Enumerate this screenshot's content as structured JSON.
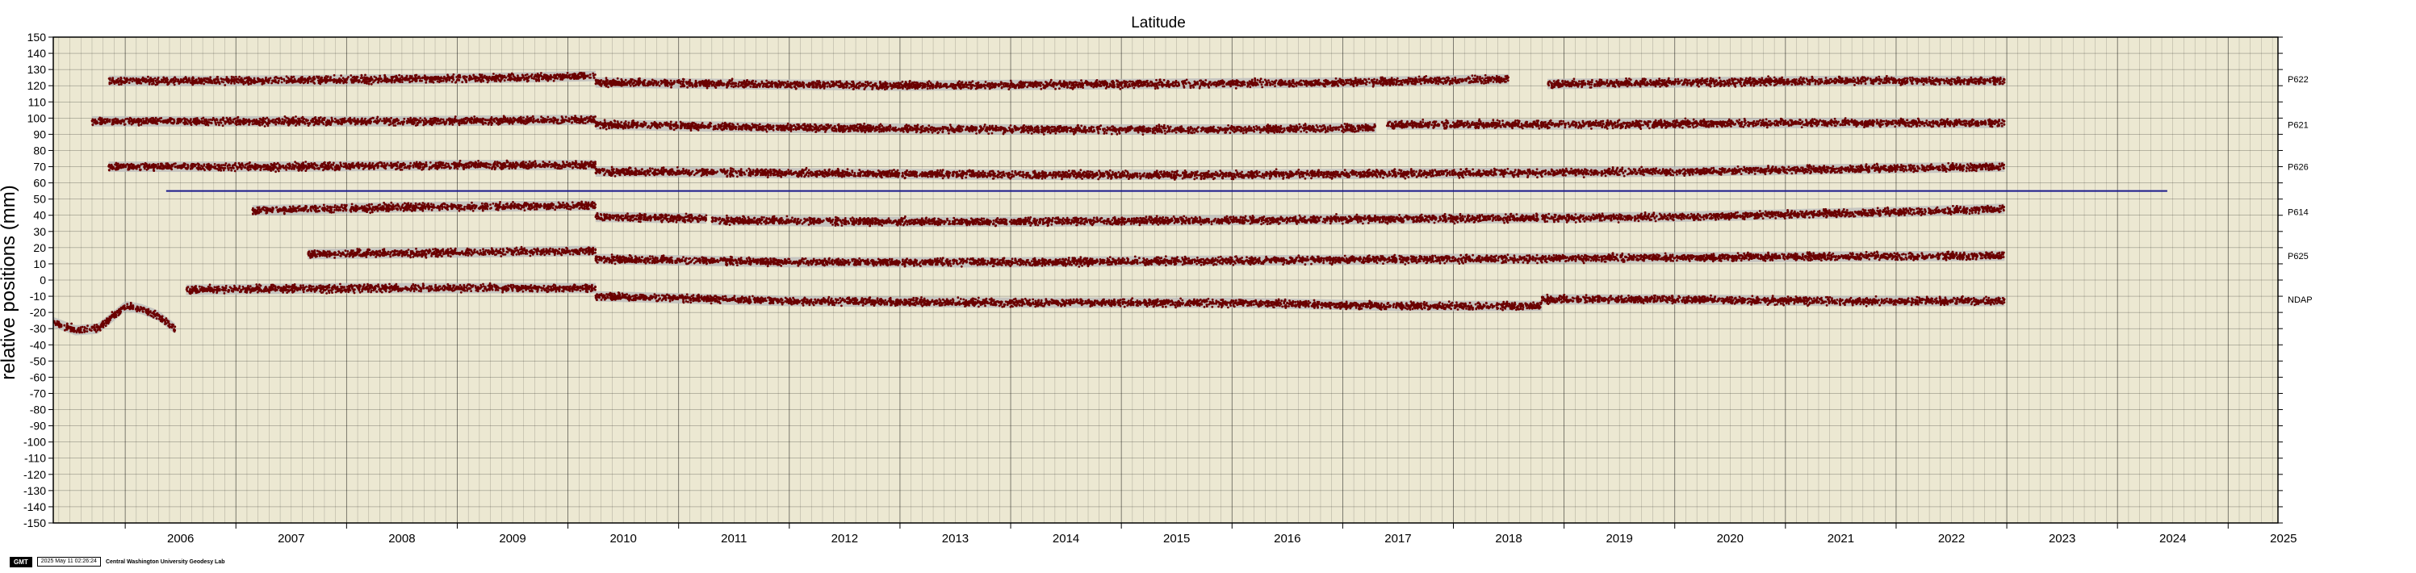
{
  "chart_data": {
    "type": "scatter",
    "title": "Latitude",
    "ylabel": "relative positions (mm)",
    "xlabel": "",
    "xlim": [
      2005.35,
      2025.45
    ],
    "ylim": [
      -150,
      150
    ],
    "y_ticks": [
      150,
      140,
      130,
      120,
      110,
      100,
      90,
      80,
      70,
      60,
      50,
      40,
      30,
      20,
      10,
      0,
      -10,
      -20,
      -30,
      -40,
      -50,
      -60,
      -70,
      -80,
      -90,
      -100,
      -110,
      -120,
      -130,
      -140,
      -150
    ],
    "x_ticks": [
      "2006",
      "2007",
      "2008",
      "2009",
      "2010",
      "2011",
      "2012",
      "2013",
      "2014",
      "2015",
      "2016",
      "2017",
      "2018",
      "2019",
      "2020",
      "2021",
      "2022",
      "2023",
      "2024",
      "2025"
    ],
    "grid": true,
    "background_color": "#ece8d2",
    "point_color": "#6b0000",
    "band_color": "#b9b9b9",
    "reference_line": {
      "y": 55,
      "x_start": 2006.37,
      "x_end": 2024.45,
      "color": "#1a1a8c"
    },
    "series": [
      {
        "name": "P622",
        "label_y": 124,
        "segments": [
          {
            "x": [
              2005.85,
              2007.0,
              2008.5,
              2009.5,
              2010.25
            ],
            "y": [
              123,
              123,
              124,
              125,
              126
            ]
          },
          {
            "x": [
              2010.25,
              2011.5,
              2013.0,
              2015.0,
              2017.0,
              2018.5
            ],
            "y": [
              122,
              121,
              120,
              121,
              122,
              124
            ]
          },
          {
            "x": [
              2018.85,
              2020.0,
              2021.5,
              2022.98
            ],
            "y": [
              121,
              122,
              123,
              123
            ]
          }
        ]
      },
      {
        "name": "P621",
        "label_y": 96,
        "segments": [
          {
            "x": [
              2005.7,
              2007.0,
              2008.5,
              2010.25
            ],
            "y": [
              98,
              98,
              98,
              99
            ]
          },
          {
            "x": [
              2010.25,
              2012.0,
              2014.0,
              2016.0,
              2017.3
            ],
            "y": [
              96,
              94,
              93,
              93,
              94
            ]
          },
          {
            "x": [
              2017.4,
              2019.0,
              2021.0,
              2022.98
            ],
            "y": [
              96,
              96,
              97,
              97
            ]
          }
        ]
      },
      {
        "name": "P626",
        "label_y": 70,
        "segments": [
          {
            "x": [
              2005.85,
              2007.5,
              2009.0,
              2010.25
            ],
            "y": [
              70,
              70,
              71,
              71
            ]
          },
          {
            "x": [
              2010.25,
              2012.0,
              2014.0,
              2016.0,
              2018.0,
              2020.0,
              2022.98
            ],
            "y": [
              67,
              66,
              65,
              65,
              66,
              67,
              70
            ]
          }
        ]
      },
      {
        "name": "P614",
        "label_y": 42,
        "segments": [
          {
            "x": [
              2007.15,
              2008.5,
              2010.25
            ],
            "y": [
              43,
              45,
              46
            ]
          },
          {
            "x": [
              2010.25,
              2011.25
            ],
            "y": [
              39,
              38
            ]
          },
          {
            "x": [
              2011.3,
              2012.5,
              2014.0,
              2016.0,
              2018.0,
              2020.0,
              2022.0,
              2022.98
            ],
            "y": [
              37,
              36,
              36,
              37,
              38,
              39,
              42,
              44
            ]
          }
        ]
      },
      {
        "name": "P625",
        "label_y": 15,
        "segments": [
          {
            "x": [
              2007.65,
              2009.0,
              2010.25
            ],
            "y": [
              16,
              17,
              18
            ]
          },
          {
            "x": [
              2010.25,
              2012.0,
              2014.0,
              2016.0,
              2018.0,
              2020.0,
              2022.98
            ],
            "y": [
              13,
              11,
              11,
              12,
              13,
              14,
              15
            ]
          }
        ]
      },
      {
        "name": "NDAP",
        "label_y": -12,
        "segments": [
          {
            "x": [
              2005.35,
              2005.55,
              2005.75,
              2005.9,
              2006.0,
              2006.15,
              2006.3,
              2006.45
            ],
            "y": [
              -26,
              -31,
              -30,
              -22,
              -16,
              -18,
              -22,
              -30
            ]
          },
          {
            "x": [
              2006.55,
              2008.0,
              2009.5,
              2010.25
            ],
            "y": [
              -6,
              -5,
              -5,
              -5
            ]
          },
          {
            "x": [
              2010.25,
              2012.0,
              2014.0,
              2016.0,
              2017.5,
              2018.8
            ],
            "y": [
              -10,
              -13,
              -14,
              -14,
              -16,
              -16
            ]
          },
          {
            "x": [
              2018.8,
              2020.0,
              2021.5,
              2022.98
            ],
            "y": [
              -12,
              -12,
              -13,
              -13
            ]
          }
        ]
      }
    ]
  },
  "footer": {
    "logo": "GMT",
    "timestamp": "2025 May 11 02:26:24",
    "credit": "Central Washington University Geodesy Lab"
  }
}
